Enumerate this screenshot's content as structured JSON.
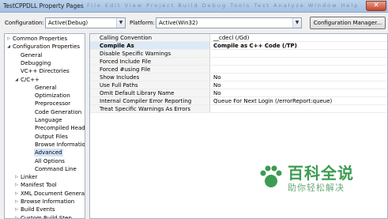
{
  "window": {
    "title": "TestCPPDLL Property Pages",
    "background_menu": "File   Edit   View   Project   Build   Debug   Tools   Test   Analyze   Window   Help",
    "close_glyph": "✕"
  },
  "config_bar": {
    "configuration_label": "Configuration:",
    "configuration_value": "Active(Debug)",
    "platform_label": "Platform:",
    "platform_value": "Active(Win32)",
    "manager_button": "Configuration Manager..."
  },
  "tree": {
    "items": [
      {
        "label": "Common Properties",
        "arrow": "▷"
      },
      {
        "label": "Configuration Properties",
        "arrow": "◢"
      },
      {
        "label": "General",
        "arrow": ""
      },
      {
        "label": "Debugging",
        "arrow": ""
      },
      {
        "label": "VC++ Directories",
        "arrow": ""
      },
      {
        "label": "C/C++",
        "arrow": "◢"
      },
      {
        "label": "General",
        "arrow": ""
      },
      {
        "label": "Optimization",
        "arrow": ""
      },
      {
        "label": "Preprocessor",
        "arrow": ""
      },
      {
        "label": "Code Generation",
        "arrow": ""
      },
      {
        "label": "Language",
        "arrow": ""
      },
      {
        "label": "Precompiled Header",
        "arrow": ""
      },
      {
        "label": "Output Files",
        "arrow": ""
      },
      {
        "label": "Browse Information",
        "arrow": ""
      },
      {
        "label": "Advanced",
        "arrow": ""
      },
      {
        "label": "All Options",
        "arrow": ""
      },
      {
        "label": "Command Line",
        "arrow": ""
      },
      {
        "label": "Linker",
        "arrow": "▷"
      },
      {
        "label": "Manifest Tool",
        "arrow": "▷"
      },
      {
        "label": "XML Document Generat",
        "arrow": "▷"
      },
      {
        "label": "Browse Information",
        "arrow": "▷"
      },
      {
        "label": "Build Events",
        "arrow": "▷"
      },
      {
        "label": "Custom Build Step",
        "arrow": "▷"
      }
    ]
  },
  "properties": {
    "rows": [
      {
        "name": "Calling Convention",
        "value": "__cdecl (/Gd)"
      },
      {
        "name": "Compile As",
        "value": "Compile as C++ Code (/TP)"
      },
      {
        "name": "Disable Specific Warnings",
        "value": ""
      },
      {
        "name": "Forced Include File",
        "value": ""
      },
      {
        "name": "Forced #using File",
        "value": ""
      },
      {
        "name": "Show Includes",
        "value": "No"
      },
      {
        "name": "Use Full Paths",
        "value": "No"
      },
      {
        "name": "Omit Default Library Name",
        "value": "No"
      },
      {
        "name": "Internal Compiler Error Reporting",
        "value": "Queue For Next Login (/errorReport:queue)"
      },
      {
        "name": "Treat Specific Warnings As Errors",
        "value": ""
      }
    ]
  },
  "watermark": {
    "title": "百科全说",
    "subtitle": "助你轻松解决",
    "color": "#3c9c52"
  }
}
